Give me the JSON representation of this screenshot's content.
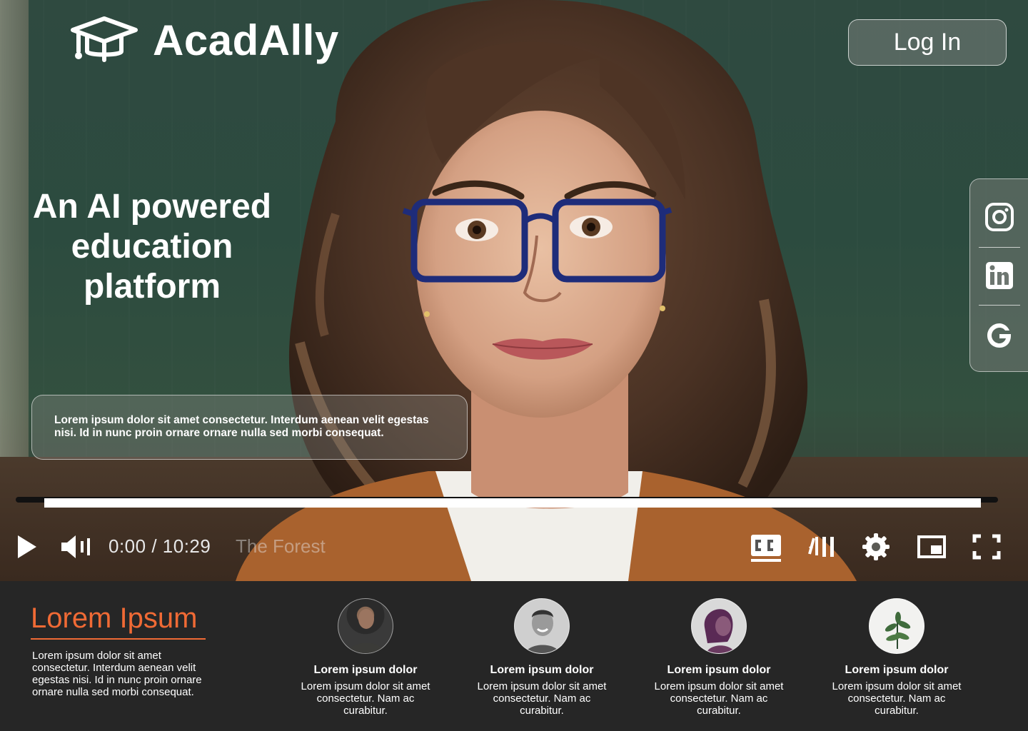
{
  "brand": {
    "name": "AcadAlly",
    "icon": "graduation-cap-icon"
  },
  "header": {
    "login_label": "Log In"
  },
  "hero": {
    "headline": [
      "An AI powered",
      "education",
      "platform"
    ],
    "description": "Lorem ipsum dolor sit amet consectetur. Interdum aenean velit egestas nisi. Id in nunc proin ornare ornare nulla sed morbi consequat."
  },
  "social": [
    {
      "name": "instagram",
      "icon": "instagram-icon"
    },
    {
      "name": "linkedin",
      "icon": "linkedin-icon"
    },
    {
      "name": "google",
      "icon": "google-icon"
    }
  ],
  "video": {
    "current_time": "0:00",
    "duration": "10:29",
    "time_label": "0:00 / 10:29",
    "title": "The Forest",
    "progress": 0.0,
    "controls": [
      "play-icon",
      "volume-icon",
      "captions-icon",
      "autoplay-icon",
      "settings-icon",
      "miniplayer-icon",
      "fullscreen-icon"
    ]
  },
  "footer": {
    "title": "Lorem Ipsum",
    "text": "Lorem ipsum dolor sit amet consectetur. Interdum aenean velit egestas nisi. Id in nunc proin ornare ornare nulla sed morbi consequat.",
    "cards": [
      {
        "title": "Lorem ipsum dolor",
        "text": "Lorem ipsum dolor sit amet consectetur. Nam ac curabitur.",
        "avatar": "man-dark-sweater"
      },
      {
        "title": "Lorem ipsum dolor",
        "text": "Lorem ipsum dolor sit amet consectetur. Nam ac curabitur.",
        "avatar": "man-smiling-bw"
      },
      {
        "title": "Lorem ipsum dolor",
        "text": "Lorem ipsum dolor sit amet consectetur. Nam ac curabitur.",
        "avatar": "woman-purple-hair"
      },
      {
        "title": "Lorem ipsum dolor",
        "text": "Lorem ipsum dolor sit amet consectetur. Nam ac curabitur.",
        "avatar": "plant"
      }
    ]
  },
  "colors": {
    "accent": "#f06a35",
    "footer_bg": "#262626",
    "board": "#2f4a40"
  }
}
